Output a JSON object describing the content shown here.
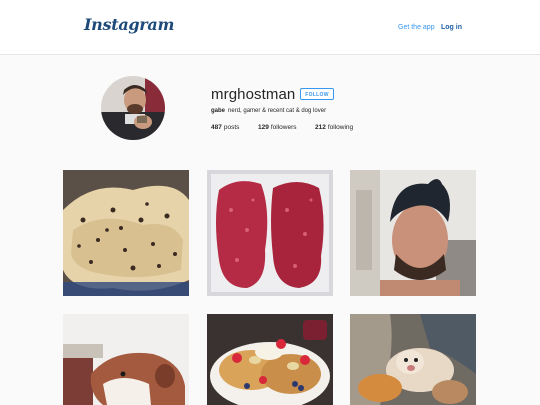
{
  "header": {
    "logo_text": "Instagram",
    "get_app_label": "Get the app",
    "login_label": "Log in"
  },
  "profile": {
    "username": "mrghostman",
    "follow_label": "FOLLOW",
    "full_name": "gabe",
    "bio": "nerd, gamer & recent cat & dog lover",
    "stats": {
      "posts_count": "487",
      "posts_label": "posts",
      "followers_count": "129",
      "followers_label": "followers",
      "following_count": "212",
      "following_label": "following"
    }
  },
  "grid": [
    {
      "subject": "cookie dough"
    },
    {
      "subject": "raw ground meat"
    },
    {
      "subject": "selfie of man"
    },
    {
      "subject": "dog close-up"
    },
    {
      "subject": "pancakes with fruit"
    },
    {
      "subject": "dog in lap"
    }
  ],
  "colors": {
    "link": "#3897f0",
    "logo": "#1d4a78",
    "background": "#fafafa"
  }
}
